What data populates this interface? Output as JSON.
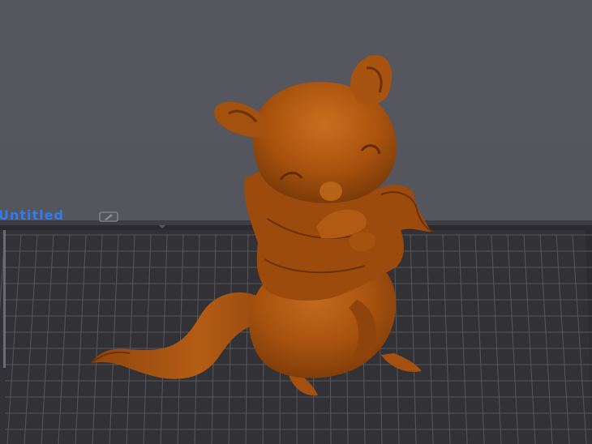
{
  "plate": {
    "name": "Untitled",
    "edit_icon": "pencil-edit-icon"
  },
  "colors": {
    "background": "#55555d",
    "plate_surface": "#2c2c30",
    "grid_line": "#4a4a50",
    "plate_label": "#2e7cf2",
    "model": "#a8520f"
  },
  "model": {
    "type": "3d-figurine-mouse"
  }
}
